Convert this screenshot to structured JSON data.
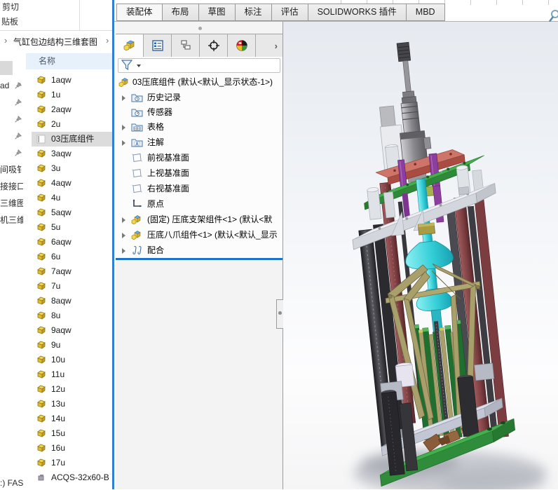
{
  "explorer": {
    "clipboard": {
      "cut": "剪切",
      "board": "贴板"
    },
    "breadcrumb": {
      "sep": "›",
      "path": "气缸包边结构三维套图"
    },
    "list": {
      "header": "名称"
    },
    "nav": [
      {
        "label": "ad",
        "pinned": true
      },
      {
        "label": "",
        "pinned": true
      },
      {
        "label": "",
        "pinned": true
      },
      {
        "label": "",
        "pinned": true
      },
      {
        "label": "",
        "pinned": true
      },
      {
        "label": "间吸钅",
        "pinned": false
      },
      {
        "label": "接接口",
        "pinned": false
      },
      {
        "label": "三维图",
        "pinned": false
      },
      {
        "label": "机三维",
        "pinned": false
      }
    ],
    "drive_fragment": ":) FAS",
    "files": [
      {
        "name": "1aqw"
      },
      {
        "name": "1u"
      },
      {
        "name": "2aqw"
      },
      {
        "name": "2u"
      },
      {
        "name": "03压底组件",
        "selected": true
      },
      {
        "name": "3aqw"
      },
      {
        "name": "3u"
      },
      {
        "name": "4aqw"
      },
      {
        "name": "4u"
      },
      {
        "name": "5aqw"
      },
      {
        "name": "5u"
      },
      {
        "name": "6aqw"
      },
      {
        "name": "6u"
      },
      {
        "name": "7aqw"
      },
      {
        "name": "7u"
      },
      {
        "name": "8aqw"
      },
      {
        "name": "8u"
      },
      {
        "name": "9aqw"
      },
      {
        "name": "9u"
      },
      {
        "name": "10u"
      },
      {
        "name": "11u"
      },
      {
        "name": "12u"
      },
      {
        "name": "13u"
      },
      {
        "name": "14u"
      },
      {
        "name": "15u"
      },
      {
        "name": "16u"
      },
      {
        "name": "17u"
      },
      {
        "name": "ACQS-32x60-B",
        "icon": "toolbox-part"
      }
    ]
  },
  "sw": {
    "tabs": [
      "装配体",
      "布局",
      "草图",
      "标注",
      "评估",
      "SOLIDWORKS 插件",
      "MBD"
    ],
    "active_tab": "装配体",
    "panel_tabs": [
      "feature-manager",
      "property-manager",
      "configuration-manager",
      "dimxpert-manager",
      "display-manager"
    ],
    "tree": {
      "root": "03压底组件 (默认<默认_显示状态-1>)",
      "items": [
        {
          "label": "历史记录",
          "icon": "history-folder",
          "expandable": true
        },
        {
          "label": "传感器",
          "icon": "sensors-folder",
          "expandable": false
        },
        {
          "label": "表格",
          "icon": "tables-folder",
          "expandable": true
        },
        {
          "label": "注解",
          "icon": "annotations-folder",
          "expandable": true
        },
        {
          "label": "前视基准面",
          "icon": "plane",
          "expandable": false
        },
        {
          "label": "上视基准面",
          "icon": "plane",
          "expandable": false
        },
        {
          "label": "右视基准面",
          "icon": "plane",
          "expandable": false
        },
        {
          "label": "原点",
          "icon": "origin",
          "expandable": false
        },
        {
          "label": "(固定) 压底支架组件<1> (默认<默",
          "icon": "subassembly",
          "expandable": true
        },
        {
          "label": "压底八爪组件<1> (默认<默认_显示",
          "icon": "subassembly",
          "expandable": true
        },
        {
          "label": "配合",
          "icon": "mates",
          "expandable": true
        }
      ]
    },
    "colors": {
      "accent_blue": "#2f80d5",
      "rollback_bar": "#1b72cc",
      "selection_gray": "#dcdcdc",
      "viewport_top": "#e6eaf0",
      "viewport_bottom": "#f5f5f6",
      "model_green": "#43b04b",
      "model_cyan": "#35cfd8",
      "model_purple": "#8d3f9d",
      "model_maroon": "#8c4b4e",
      "model_khaki": "#a89f6a",
      "model_red_bracket": "#cf7468"
    }
  }
}
